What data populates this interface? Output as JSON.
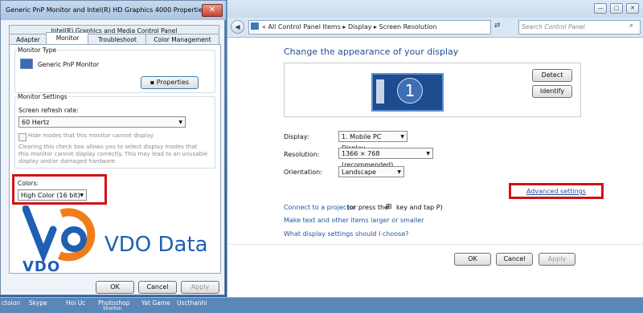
{
  "desktop": {
    "taskbar_items": [
      "ctoion",
      "Skype",
      "Hoi Uc",
      "Photoshop",
      "Shorton",
      "Yat Game",
      "Uscthanhi"
    ]
  },
  "control_panel": {
    "window_controls": [
      "—",
      "▢",
      "✕"
    ],
    "breadcrumbs": "«  All Control Panel Items  ▸  Display  ▸  Screen Resolution",
    "search_placeholder": "Search Control Panel",
    "title": "Change the appearance of your display",
    "monitor_number": "1",
    "detect_label": "Detect",
    "identify_label": "Identify",
    "display_label": "Display:",
    "display_value": "1. Mobile PC Display",
    "resolution_label": "Resolution:",
    "resolution_value": "1366 × 768 (recommended)",
    "orientation_label": "Orientation:",
    "orientation_value": "Landscape",
    "advanced_link": "Advanced settings",
    "projector_link": "Connect to a projector",
    "projector_rest": "(or press the",
    "projector_rest2": "key and tap P)",
    "text_size_link": "Make text and other items larger or smaller",
    "which_settings_link": "What display settings should I choose?",
    "ok_label": "OK",
    "cancel_label": "Cancel",
    "apply_label": "Apply"
  },
  "dialog": {
    "title": "Generic PnP Monitor and Intel(R) HD Graphics 4000 Properties",
    "close_label": "✕",
    "tab_top": "Intel(R) Graphics and Media Control Panel",
    "tabs": [
      "Adapter",
      "Monitor",
      "Troubleshoot",
      "Color Management"
    ],
    "monitor_type_group": "Monitor Type",
    "monitor_name": "Generic PnP Monitor",
    "properties_label": "Properties",
    "monitor_settings_group": "Monitor Settings",
    "refresh_label": "Screen refresh rate:",
    "refresh_value": "60 Hertz",
    "hide_modes_label": "Hide modes that this monitor cannot display",
    "hide_modes_help": "Clearing this check box allows you to select display modes that this monitor cannot display correctly. This may lead to an unusable display and/or damaged hardware.",
    "colors_label": "Colors:",
    "colors_value": "High Color (16 bit)",
    "ok_label": "OK",
    "cancel_label": "Cancel",
    "apply_label": "Apply"
  },
  "watermark": {
    "brand_text": "VDO Data",
    "logo_text": "VDO"
  },
  "colors": {
    "highlight_red": "#d11414",
    "link_blue": "#1e55a4",
    "title_blue": "#1f4e91"
  }
}
